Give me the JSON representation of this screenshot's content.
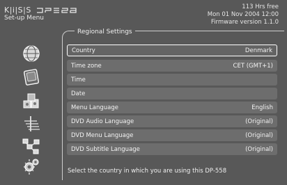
{
  "brand": {
    "logo_text": "K|i|S|S"
  },
  "header": {
    "screen_title": "Set-up Menu",
    "free_space": "113 Hrs free",
    "datetime": "Mon 01 Nov 2004 12:00",
    "firmware": "Firmware version 1.1.0"
  },
  "panel": {
    "title": "Regional Settings"
  },
  "sidebar": {
    "icons": [
      "globe-icon",
      "tv-screen-icon",
      "media-blocks-icon",
      "antenna-icon",
      "network-icon",
      "gears-icon"
    ]
  },
  "settings": {
    "rows": [
      {
        "label": "Country",
        "value": "Denmark",
        "selected": true
      },
      {
        "label": "Time zone",
        "value": "CET (GMT+1)"
      },
      {
        "label": "Time",
        "value": ""
      },
      {
        "label": "Date",
        "value": ""
      },
      {
        "label": "Menu Language",
        "value": "English"
      },
      {
        "label": "DVD Audio Language",
        "value": "(Original)"
      },
      {
        "label": "DVD Menu Language",
        "value": "(Original)"
      },
      {
        "label": "DVD Subtitle Language",
        "value": "(Original)"
      }
    ]
  },
  "footer": {
    "help_text": "Select the country in which you are using this DP-558"
  },
  "colors": {
    "background": "#585858",
    "row": "#6d6d6d",
    "selected_border": "#ffffff",
    "text": "#f2f2f2"
  }
}
